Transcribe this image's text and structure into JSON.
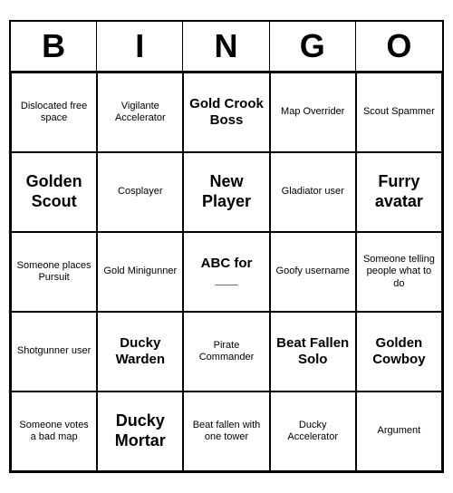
{
  "header": {
    "letters": [
      "B",
      "I",
      "N",
      "G",
      "O"
    ]
  },
  "cells": [
    {
      "text": "Dislocated free space",
      "size": "small"
    },
    {
      "text": "Vigilante Accelerator",
      "size": "small"
    },
    {
      "text": "Gold Crook Boss",
      "size": "medium"
    },
    {
      "text": "Map Overrider",
      "size": "small"
    },
    {
      "text": "Scout Spammer",
      "size": "small"
    },
    {
      "text": "Golden Scout",
      "size": "large"
    },
    {
      "text": "Cosplayer",
      "size": "small"
    },
    {
      "text": "New Player",
      "size": "large"
    },
    {
      "text": "Gladiator user",
      "size": "small"
    },
    {
      "text": "Furry avatar",
      "size": "large"
    },
    {
      "text": "Someone places Pursuit",
      "size": "small"
    },
    {
      "text": "Gold Minigunner",
      "size": "small"
    },
    {
      "text": "ABC for ___",
      "size": "medium"
    },
    {
      "text": "Goofy username",
      "size": "small"
    },
    {
      "text": "Someone telling people what to do",
      "size": "small"
    },
    {
      "text": "Shotgunner user",
      "size": "small"
    },
    {
      "text": "Ducky Warden",
      "size": "medium"
    },
    {
      "text": "Pirate Commander",
      "size": "small"
    },
    {
      "text": "Beat Fallen Solo",
      "size": "medium"
    },
    {
      "text": "Golden Cowboy",
      "size": "medium"
    },
    {
      "text": "Someone votes a bad map",
      "size": "small"
    },
    {
      "text": "Ducky Mortar",
      "size": "large"
    },
    {
      "text": "Beat fallen with one tower",
      "size": "small"
    },
    {
      "text": "Ducky Accelerator",
      "size": "small"
    },
    {
      "text": "Argument",
      "size": "small"
    }
  ]
}
